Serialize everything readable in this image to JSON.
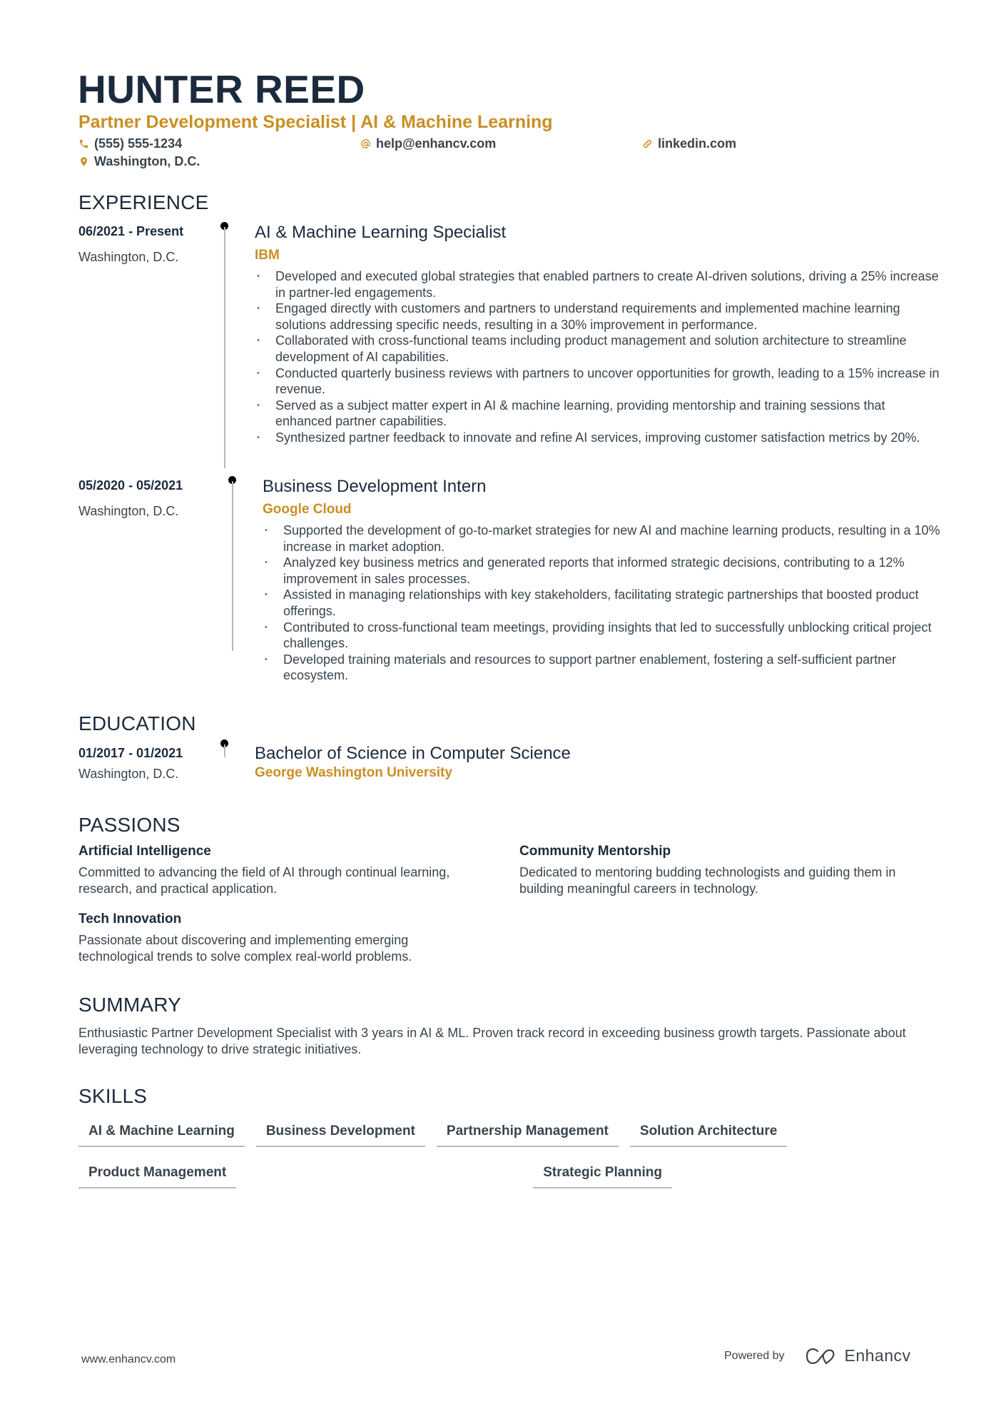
{
  "header": {
    "name": "HUNTER REED",
    "title": "Partner Development Specialist | AI & Machine Learning",
    "contacts": {
      "phone": {
        "icon": "phone-icon",
        "text": "(555) 555-1234"
      },
      "email": {
        "icon": "at-sign-icon",
        "text": "help@enhancv.com"
      },
      "website": {
        "icon": "link-icon",
        "text": "linkedin.com"
      },
      "location": {
        "icon": "location-pin-icon",
        "text": "Washington, D.C."
      }
    }
  },
  "colors": {
    "accent": "#c98f24",
    "heading": "#1b2a3d",
    "body": "#3a444d",
    "timeline": "#b8b8b8"
  },
  "experience": {
    "heading": "EXPERIENCE",
    "entries": [
      {
        "dates": "06/2021 - Present",
        "location": "Washington, D.C.",
        "role": "AI & Machine Learning Specialist",
        "company": "IBM",
        "bullets": [
          "Developed and executed global strategies that enabled partners to create AI-driven solutions, driving a 25% increase in partner-led engagements.",
          "Engaged directly with customers and partners to understand requirements and implemented machine learning solutions addressing specific needs, resulting in a 30% improvement in performance.",
          "Collaborated with cross-functional teams including product management and solution architecture to streamline development of AI capabilities.",
          "Conducted quarterly business reviews with partners to uncover opportunities for growth, leading to a 15% increase in revenue.",
          "Served as a subject matter expert in AI & machine learning, providing mentorship and training sessions that enhanced partner capabilities.",
          "Synthesized partner feedback to innovate and refine AI services, improving customer satisfaction metrics by 20%."
        ]
      },
      {
        "dates": "05/2020 - 05/2021",
        "location": "Washington, D.C.",
        "role": "Business Development Intern",
        "company": "Google Cloud",
        "bullets": [
          "Supported the development of go-to-market strategies for new AI and machine learning products, resulting in a 10% increase in market adoption.",
          "Analyzed key business metrics and generated reports that informed strategic decisions, contributing to a 12% improvement in sales processes.",
          "Assisted in managing relationships with key stakeholders, facilitating strategic partnerships that boosted product offerings.",
          "Contributed to cross-functional team meetings, providing insights that led to successfully unblocking critical project challenges.",
          "Developed training materials and resources to support partner enablement, fostering a self-sufficient partner ecosystem."
        ]
      }
    ]
  },
  "education": {
    "heading": "EDUCATION",
    "entries": [
      {
        "dates": "01/2017 - 01/2021",
        "location": "Washington, D.C.",
        "degree": "Bachelor of Science in Computer Science",
        "school": "George Washington University"
      }
    ]
  },
  "passions": {
    "heading": "PASSIONS",
    "items": [
      {
        "title": "Artificial Intelligence",
        "description": "Committed to advancing the field of AI through continual learning, research, and practical application."
      },
      {
        "title": "Community Mentorship",
        "description": "Dedicated to mentoring budding technologists and guiding them in building meaningful careers in technology."
      },
      {
        "title": "Tech Innovation",
        "description": "Passionate about discovering and implementing emerging technological trends to solve complex real-world problems."
      }
    ]
  },
  "summary": {
    "heading": "SUMMARY",
    "text": "Enthusiastic Partner Development Specialist with 3 years in AI & ML. Proven track record in exceeding business growth targets. Passionate about leveraging technology to drive strategic initiatives."
  },
  "skills": {
    "heading": "SKILLS",
    "items": [
      "AI & Machine Learning",
      "Business Development",
      "Partnership Management",
      "Solution Architecture",
      "Product Management",
      "Strategic Planning"
    ]
  },
  "footer": {
    "website": "www.enhancv.com",
    "powered_by": "Powered by",
    "brand": "Enhancv",
    "brand_icon": "enhancv-logo-icon"
  }
}
